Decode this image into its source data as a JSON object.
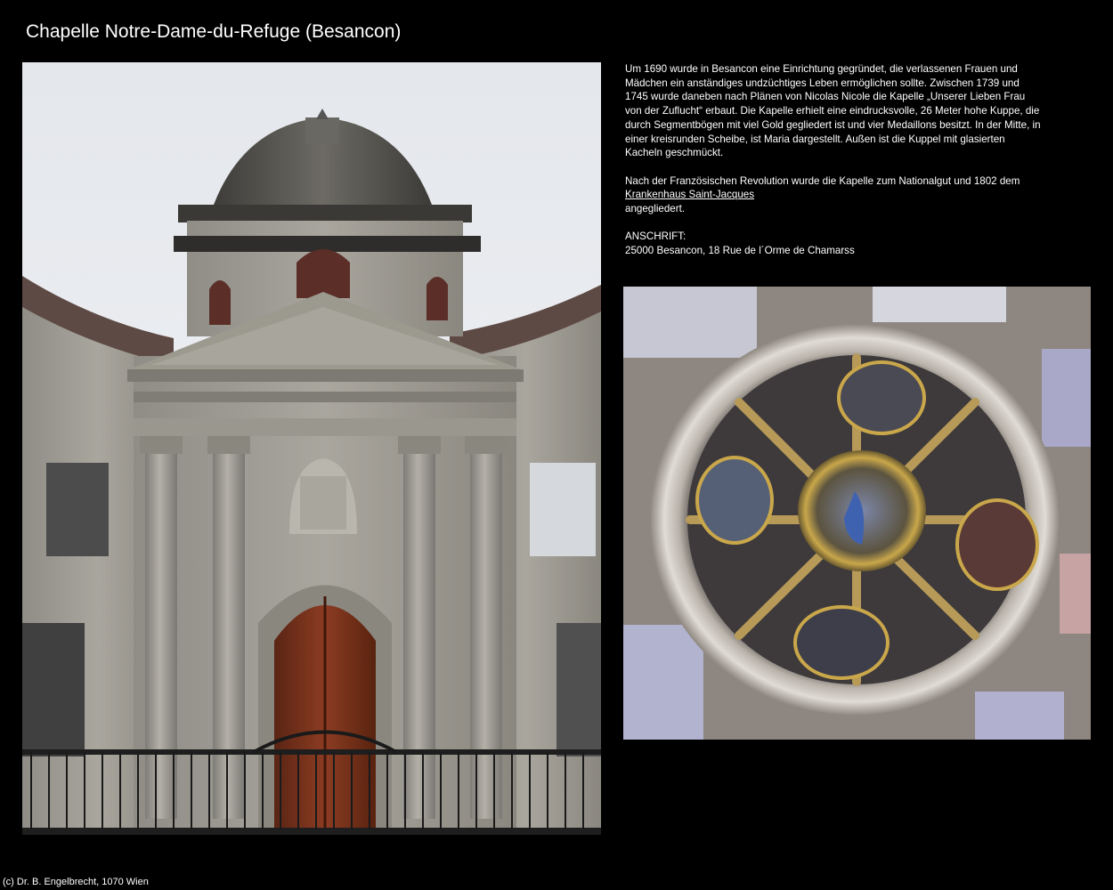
{
  "page": {
    "title": "Chapelle Notre-Dame-du-Refuge (Besancon)",
    "footer": "(c) Dr. B. Engelbrecht, 1070 Wien"
  },
  "description": {
    "paragraph1": "Um 1690 wurde in Besancon eine Einrichtung gegründet, die verlassenen Frauen und Mädchen ein anständiges undzüchtiges Leben ermöglichen sollte. Zwischen 1739 und 1745 wurde daneben nach Plänen von Nicolas Nicole die Kapelle „Unserer Lieben Frau von der Zuflucht“ erbaut. Die Kapelle erhielt eine eindrucksvolle, 26 Meter hohe Kuppe, die durch Segmentbögen mit viel Gold gegliedert ist und vier Medaillons besitzt. In der Mitte, in einer kreisrunden Scheibe, ist Maria dargestellt. Außen ist die Kuppel mit glasierten Kacheln geschmückt.",
    "paragraph2_before_link": "Nach der Französischen Revolution wurde die Kapelle zum Nationalgut und 1802 dem",
    "link_text": "Krankenhaus Saint-Jacques",
    "paragraph2_after_link": "angegliedert.",
    "address_label": "ANSCHRIFT:",
    "address": "25000 Besancon, 18 Rue de l´Orme de Chamarss"
  },
  "colors": {
    "background": "#000000",
    "text": "#ffffff"
  }
}
